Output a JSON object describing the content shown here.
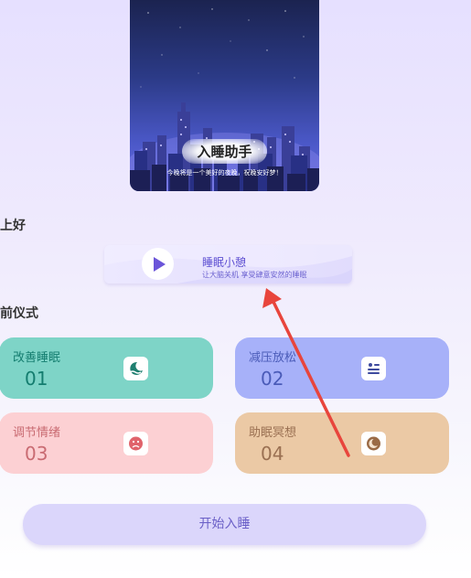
{
  "hero": {
    "title": "入睡助手",
    "subtitle": "今晚将是一个美好的夜晚，祝晚安好梦！"
  },
  "greeting_label": "上好",
  "nap": {
    "title": "睡眠小憩",
    "subtitle": "让大脑关机 享受肆意安然的睡眠",
    "icon": "play-icon"
  },
  "ritual_label": "前仪式",
  "rituals": [
    {
      "label": "改善睡眠",
      "number": "01",
      "icon": "moon-wave-icon",
      "color": "#7ed4c7"
    },
    {
      "label": "减压放松",
      "number": "02",
      "icon": "relax-face-icon",
      "color": "#a7b1f9"
    },
    {
      "label": "调节情绪",
      "number": "03",
      "icon": "sad-face-icon",
      "color": "#fcd0d3"
    },
    {
      "label": "助眠冥想",
      "number": "04",
      "icon": "meditation-icon",
      "color": "#ebc9a5"
    }
  ],
  "start_button": "开始入睡",
  "annotation": {
    "type": "red-arrow",
    "color": "#e8453c"
  }
}
